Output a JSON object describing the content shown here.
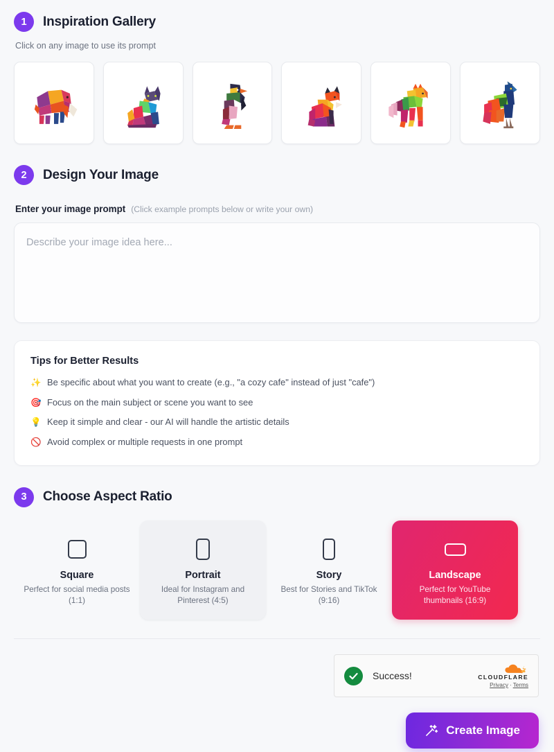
{
  "steps": {
    "gallery": {
      "number": "1",
      "title": "Inspiration Gallery",
      "note": "Click on any image to use its prompt"
    },
    "design": {
      "number": "2",
      "title": "Design Your Image"
    },
    "ratio": {
      "number": "3",
      "title": "Choose Aspect Ratio"
    }
  },
  "gallery": {
    "items": [
      {
        "name": "elephant",
        "alt": "Low-poly geometric elephant"
      },
      {
        "name": "cat",
        "alt": "Low-poly geometric cat"
      },
      {
        "name": "penguin",
        "alt": "Low-poly geometric penguin"
      },
      {
        "name": "fox",
        "alt": "Low-poly geometric fox"
      },
      {
        "name": "horse",
        "alt": "Low-poly geometric horse"
      },
      {
        "name": "peacock",
        "alt": "Low-poly geometric peacock"
      }
    ]
  },
  "prompt": {
    "label": "Enter your image prompt",
    "hint": "(Click example prompts below or write your own)",
    "value": "",
    "placeholder": "Describe your image idea here..."
  },
  "tips": {
    "title": "Tips for Better Results",
    "items": [
      {
        "icon": "✨",
        "icon_name": "sparkles-icon",
        "text": "Be specific about what you want to create (e.g., \"a cozy cafe\" instead of just \"cafe\")"
      },
      {
        "icon": "🎯",
        "icon_name": "target-icon",
        "text": "Focus on the main subject or scene you want to see"
      },
      {
        "icon": "💡",
        "icon_name": "lightbulb-icon",
        "text": "Keep it simple and clear - our AI will handle the artistic details"
      },
      {
        "icon": "🚫",
        "icon_name": "prohibited-icon",
        "text": "Avoid complex or multiple requests in one prompt"
      }
    ]
  },
  "aspect_ratios": {
    "options": [
      {
        "name": "Square",
        "desc": "Perfect for social media posts (1:1)",
        "ratio": "1:1",
        "state": "default",
        "icon": "square-outline-icon"
      },
      {
        "name": "Portrait",
        "desc": "Ideal for Instagram and Pinterest (4:5)",
        "ratio": "4:5",
        "state": "hover",
        "icon": "portrait-outline-icon"
      },
      {
        "name": "Story",
        "desc": "Best for Stories and TikTok (9:16)",
        "ratio": "9:16",
        "state": "default",
        "icon": "story-outline-icon"
      },
      {
        "name": "Landscape",
        "desc": "Perfect for YouTube thumbnails (16:9)",
        "ratio": "16:9",
        "state": "selected",
        "icon": "landscape-outline-icon"
      }
    ]
  },
  "turnstile": {
    "status": "Success!",
    "brand": "CLOUDFLARE",
    "privacy_label": "Privacy",
    "separator": "·",
    "terms_label": "Terms"
  },
  "cta": {
    "label": "Create Image",
    "icon": "magic-wand-icon"
  },
  "colors": {
    "accent_purple": "#7c3aed",
    "badge_purple": "#7c3aed",
    "selected_pink": "#e0266f",
    "selected_red": "#f2284f",
    "page_background": "#f7f8fa",
    "success_green": "#148b3f",
    "cloudflare_orange": "#f6821f"
  }
}
